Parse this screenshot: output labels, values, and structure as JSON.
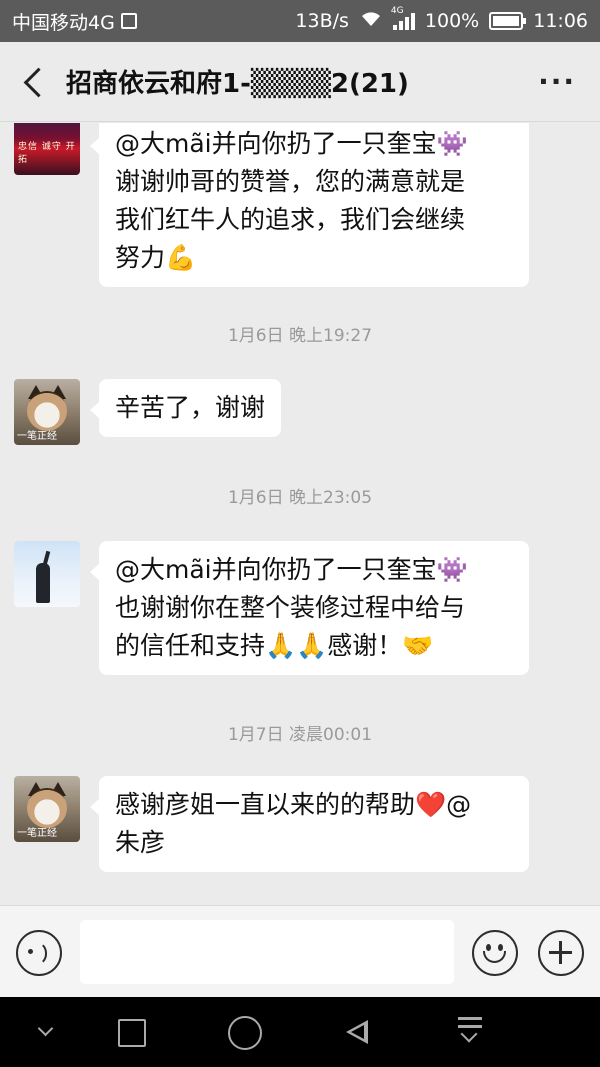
{
  "status_bar": {
    "carrier": "中国移动4G",
    "speed": "13B/s",
    "network": "4G",
    "battery": "100%",
    "battery_level": 1.0,
    "time": "11:06"
  },
  "header": {
    "title": "招商依云和府1-▒▒▒▒2(21)",
    "more": "···"
  },
  "messages": [
    {
      "avatar": "banner-avatar",
      "avatar_text": "忠信 诚守 开拓",
      "lines": [
        "@大mãi并向你扔了一只奎宝👾",
        "谢谢帅哥的赞誉，您的满意就是",
        "我们红牛人的追求，我们会继续",
        "努力💪"
      ]
    },
    {
      "time": "1月6日 晚上19:27"
    },
    {
      "avatar": "cat-avatar",
      "avatar_text": "一笔正经",
      "lines": [
        "辛苦了，谢谢"
      ]
    },
    {
      "time": "1月6日 晚上23:05"
    },
    {
      "avatar": "sky-avatar",
      "lines": [
        "@大mãi并向你扔了一只奎宝👾",
        "也谢谢你在整个装修过程中给与",
        "的信任和支持🙏🙏感谢！🤝"
      ]
    },
    {
      "time": "1月7日 凌晨00:01"
    },
    {
      "avatar": "cat-avatar",
      "avatar_text": "一笔正经",
      "lines": [
        "感谢彦姐一直以来的的帮助❤️@",
        "朱彦"
      ]
    }
  ],
  "input_bar": {
    "voice_icon": "voice-icon",
    "emoji_icon": "emoji-icon",
    "plus_icon": "plus-icon",
    "placeholder": ""
  },
  "nav_bar": {
    "icons": [
      "nav-down-icon",
      "recent-apps-icon",
      "home-icon",
      "back-icon",
      "notification-pull-icon"
    ]
  },
  "colors": {
    "status_bar": "#5b5b5b",
    "chat_background": "#ebebeb",
    "bubble": "#ffffff",
    "timestamp": "#9a9a9a",
    "nav_bar": "#000000"
  }
}
